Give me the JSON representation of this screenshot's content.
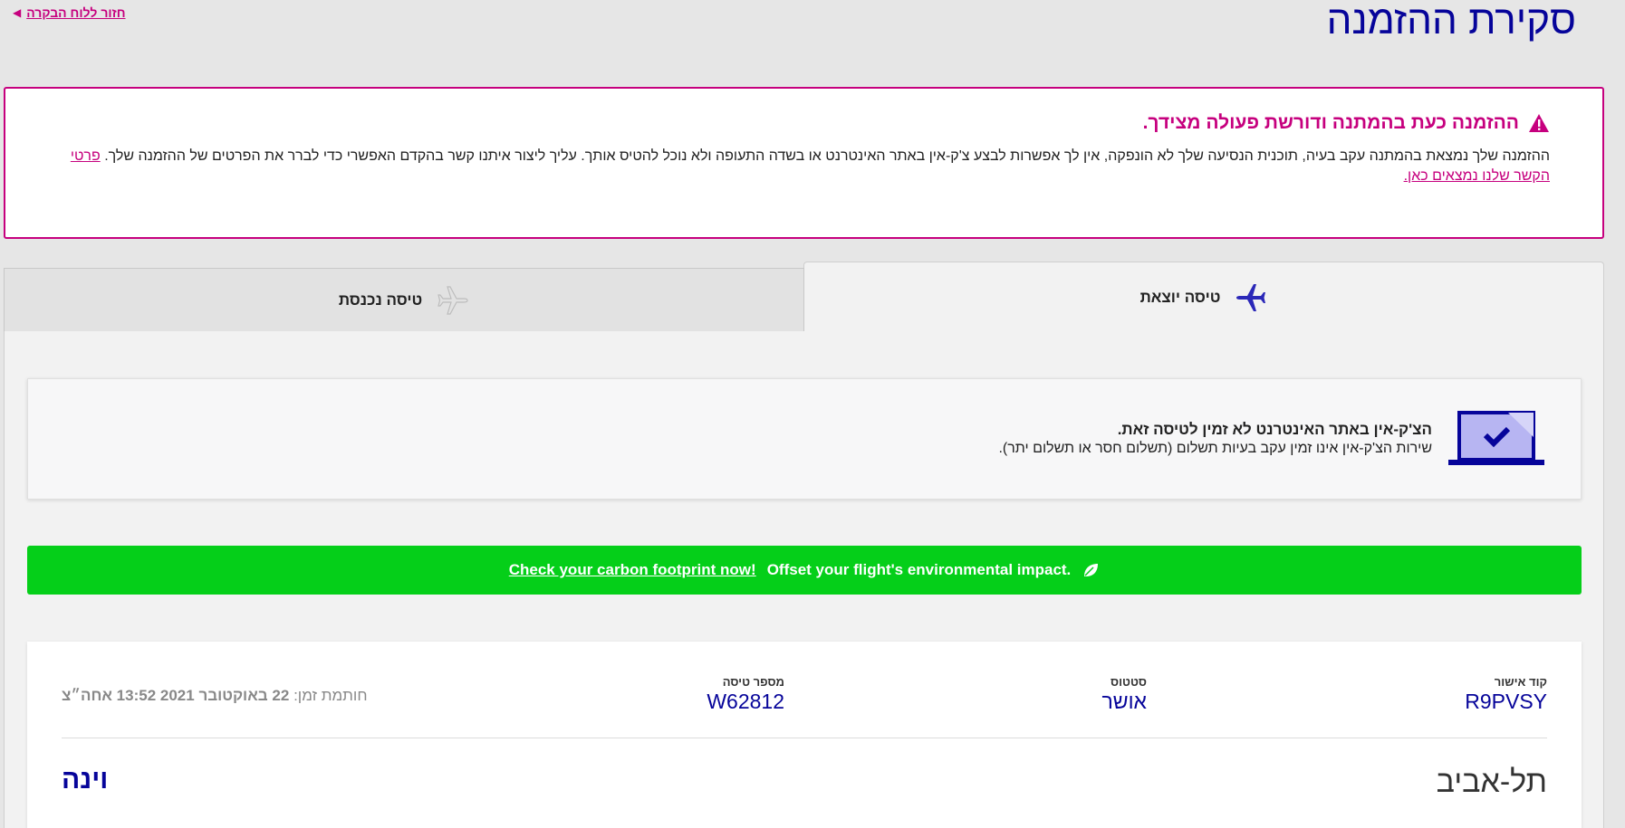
{
  "header": {
    "title": "סקירת ההזמנה",
    "back_link": "חזור ללוח הבקרה"
  },
  "alert": {
    "title": "ההזמנה כעת בהמתנה ודורשת פעולה מצידך.",
    "body": "ההזמנה שלך נמצאת בהמתנה עקב בעיה, תוכנית הנסיעה שלך לא הונפקה, אין לך אפשרות לבצע צ'ק-אין באתר האינטרנט או בשדה התעופה ולא נוכל להטיס אותך. עליך ליצור איתנו קשר בהקדם האפשרי כדי לברר את הפרטים של ההזמנה שלך.",
    "link": "פרטי הקשר שלנו נמצאים כאן."
  },
  "tabs": {
    "outbound": "טיסה יוצאת",
    "inbound": "טיסה נכנסת"
  },
  "checkin": {
    "title": "הצ'ק-אין באתר האינטרנט לא זמין לטיסה זאת.",
    "subtitle": "שירות הצ'ק-אין אינו זמין עקב בעיות תשלום (תשלום חסר או תשלום יתר)."
  },
  "carbon": {
    "text": "Offset your flight's environmental impact.",
    "link": "Check your carbon footprint now!"
  },
  "booking": {
    "confirmation_label": "קוד אישור",
    "confirmation_value": "R9PVSY",
    "status_label": "סטטוס",
    "status_value": "אושר",
    "flight_label": "מספר טיסה",
    "flight_value": "W62812",
    "timestamp_label": "חותמת זמן:",
    "timestamp_value": "22 באוקטובר 2021 13:52 אחה״צ",
    "from_city": "תל-אביב",
    "to_city": "וינה"
  },
  "colors": {
    "brand_primary": "#06049a",
    "brand_accent": "#c6007e",
    "carbon_green": "#05cf19"
  }
}
